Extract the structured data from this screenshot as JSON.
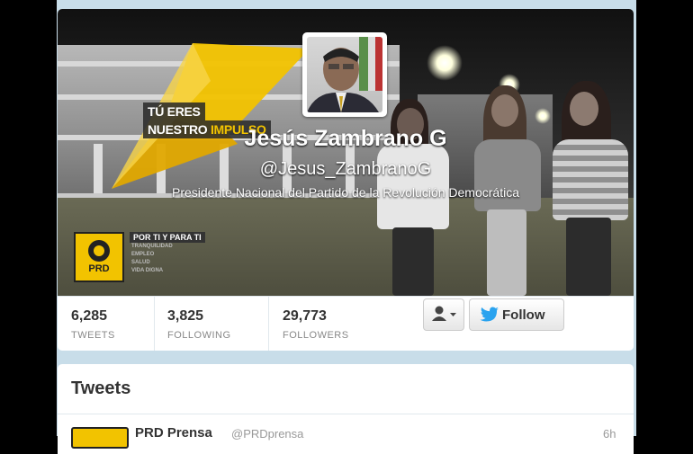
{
  "profile": {
    "name": "Jesús Zambrano G",
    "handle": "@Jesus_ZambranoG",
    "bio": "Presidente Nacional del Partido de la Revolución Democrática"
  },
  "header_banner": {
    "tagline_1": "TÚ ERES",
    "tagline_2a": "NUESTRO ",
    "tagline_2b": "IMPULSO",
    "logo_text": "PRD",
    "slogan": "POR TI Y PARA TI",
    "slogan_items": [
      "TRANQUILIDAD",
      "EMPLEO",
      "SALUD",
      "VIDA DIGNA"
    ],
    "accent_color": "#f2c300"
  },
  "stats": [
    {
      "value": "6,285",
      "label": "TWEETS"
    },
    {
      "value": "3,825",
      "label": "FOLLOWING"
    },
    {
      "value": "29,773",
      "label": "FOLLOWERS"
    }
  ],
  "actions": {
    "user_menu_icon": "user-dropdown-icon",
    "follow_label": "Follow",
    "follow_icon": "twitter-bird-icon"
  },
  "tweets": {
    "title": "Tweets",
    "first": {
      "author": "PRD Prensa",
      "handle": "@PRDprensa",
      "time": "6h"
    }
  }
}
